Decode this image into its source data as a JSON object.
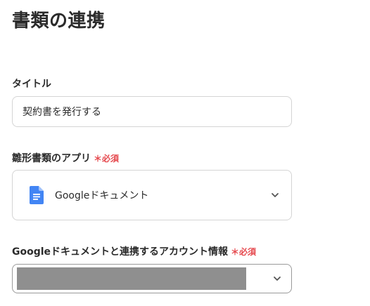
{
  "page": {
    "title": "書類の連携"
  },
  "title_field": {
    "label": "タイトル",
    "value": "契約書を発行する"
  },
  "template_app": {
    "label": "雛形書類のアプリ",
    "required": "＊必須",
    "selected": "Googleドキュメント",
    "icon": "google-docs-icon"
  },
  "account": {
    "label": "Googleドキュメントと連携するアカウント情報",
    "required": "＊必須",
    "value_state": "redacted"
  },
  "colors": {
    "required": "#e5484d",
    "docs_blue": "#4285f4",
    "border": "#d4d4d4",
    "redaction": "#8f8f8f"
  }
}
